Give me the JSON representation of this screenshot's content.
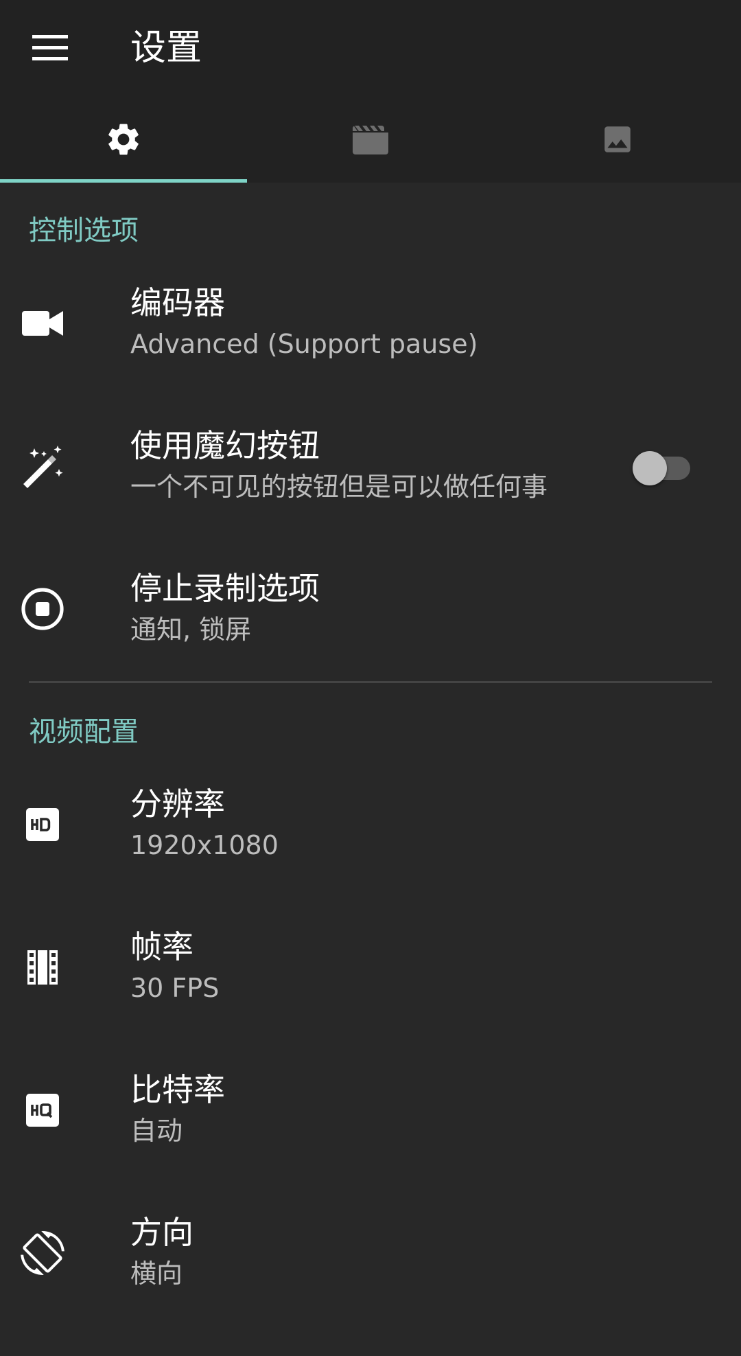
{
  "appbar": {
    "title": "设置",
    "menu_icon": "menu-icon"
  },
  "tabs": [
    {
      "icon": "gear-icon",
      "selected": true
    },
    {
      "icon": "clapperboard-icon",
      "selected": false
    },
    {
      "icon": "image-icon",
      "selected": false
    }
  ],
  "colors": {
    "accent": "#80cbc4",
    "background": "#282828",
    "appbar": "#222222"
  },
  "sections": [
    {
      "header": "控制选项",
      "items": [
        {
          "icon": "videocam-icon",
          "title": "编码器",
          "summary": "Advanced (Support pause)"
        },
        {
          "icon": "magic-wand-icon",
          "title": "使用魔幻按钮",
          "summary": "一个不可见的按钮但是可以做任何事",
          "toggle": false
        },
        {
          "icon": "stop-circle-icon",
          "title": "停止录制选项",
          "summary": "通知, 锁屏"
        }
      ]
    },
    {
      "header": "视频配置",
      "items": [
        {
          "icon": "hd-icon",
          "title": "分辨率",
          "summary": "1920x1080"
        },
        {
          "icon": "film-strip-icon",
          "title": "帧率",
          "summary": "30 FPS"
        },
        {
          "icon": "hq-icon",
          "title": "比特率",
          "summary": "自动"
        },
        {
          "icon": "screen-rotation-icon",
          "title": "方向",
          "summary": "横向"
        }
      ]
    }
  ]
}
